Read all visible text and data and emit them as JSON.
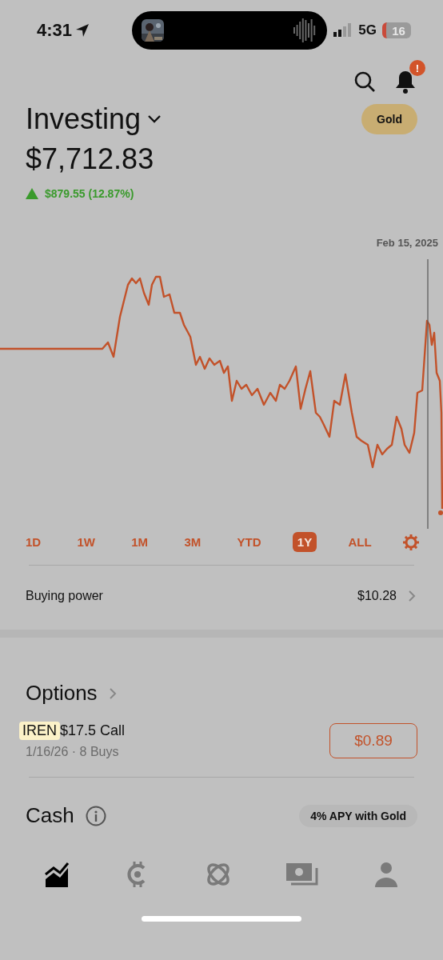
{
  "status_bar": {
    "time": "4:31",
    "network": "5G",
    "battery": "16"
  },
  "header": {
    "notification_badge": "!"
  },
  "account": {
    "title": "Investing",
    "value": "$7,712.83",
    "change": "$879.55 (12.87%)",
    "upgrade_button": "Gold"
  },
  "chart": {
    "date_label": "Feb 15, 2025"
  },
  "ranges": [
    {
      "label": "1D",
      "selected": false
    },
    {
      "label": "1W",
      "selected": false
    },
    {
      "label": "1M",
      "selected": false
    },
    {
      "label": "3M",
      "selected": false
    },
    {
      "label": "YTD",
      "selected": false
    },
    {
      "label": "1Y",
      "selected": true
    },
    {
      "label": "ALL",
      "selected": false
    }
  ],
  "buying_power": {
    "label": "Buying power",
    "value": "$10.28"
  },
  "options": {
    "title": "Options",
    "positions": [
      {
        "ticker": "IREN",
        "highlighted": true,
        "contract": "$17.5 Call",
        "detail": "1/16/26 · 8 Buys",
        "price": "$0.89"
      }
    ]
  },
  "cash": {
    "title": "Cash",
    "promo": "4% APY with Gold"
  },
  "nav_items": [
    {
      "selected": true
    },
    {
      "selected": false
    },
    {
      "selected": false
    },
    {
      "selected": false
    },
    {
      "selected": false
    }
  ]
}
